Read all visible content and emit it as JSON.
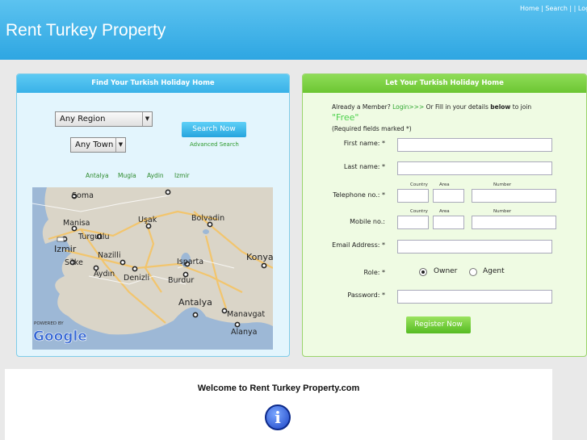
{
  "header": {
    "site_title": "Rent Turkey Property",
    "nav": {
      "home": "Home",
      "sep1": " | ",
      "search": "Search",
      "sep2": " | | ",
      "login": "Login"
    }
  },
  "find_panel": {
    "title": "Find Your Turkish Holiday Home",
    "region_select": "Any Region",
    "town_select": "Any Town",
    "search_button": "Search Now",
    "advanced_search": "Advanced Search",
    "city_links": [
      "Antalya",
      "Mugla",
      "Aydin",
      "Izmir"
    ],
    "map": {
      "labels": [
        "Soma",
        "Manisa",
        "Turgutlu",
        "Uşak",
        "Bolvadin",
        "Izmir",
        "Nazilli",
        "Söke",
        "Aydın",
        "Denizli",
        "Isparta",
        "Burdur",
        "Konya",
        "Antalya",
        "Manavgat",
        "Alanya"
      ],
      "powered_by": "POWERED BY",
      "google": "Google"
    }
  },
  "register_panel": {
    "title": "Let Your Turkish Holiday Home",
    "intro_a": "Already a Member?",
    "intro_login": "Login>>>",
    "intro_b": "Or Fill in your details",
    "intro_bold": "below",
    "intro_c": "to join",
    "intro_free": "\"Free\"",
    "intro_required": "(Required fields marked *)",
    "first_name": "First name: *",
    "last_name": "Last name: *",
    "telephone": "Telephone no.: *",
    "mobile": "Mobile no.:",
    "email": "Email Address: *",
    "role": "Role: *",
    "password": "Password: *",
    "sub_country": "Country",
    "sub_area": "Area",
    "sub_number": "Number",
    "role_owner": "Owner",
    "role_agent": "Agent",
    "register_button": "Register Now"
  },
  "welcome": {
    "title": "Welcome to Rent Turkey Property.com"
  }
}
